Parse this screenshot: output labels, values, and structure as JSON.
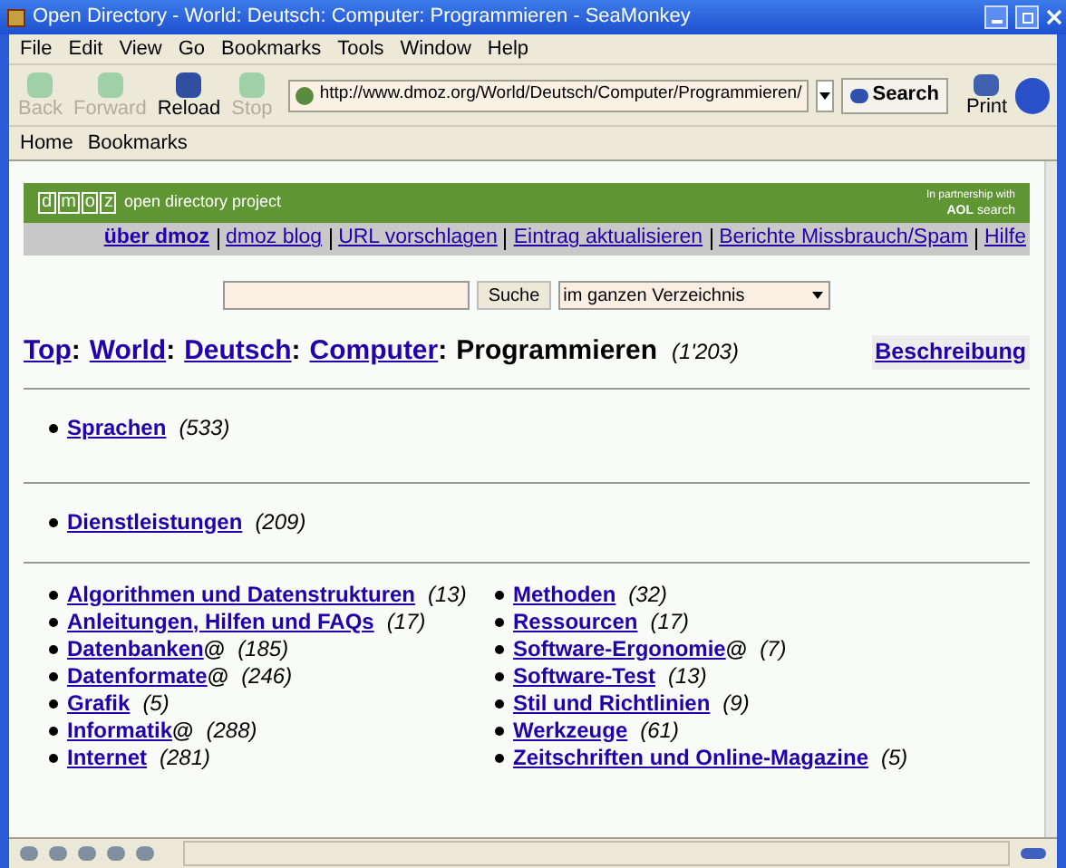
{
  "window": {
    "title": "Open Directory - World: Deutsch: Computer: Programmieren - SeaMonkey"
  },
  "menu": [
    "File",
    "Edit",
    "View",
    "Go",
    "Bookmarks",
    "Tools",
    "Window",
    "Help"
  ],
  "toolbar": {
    "buttons": [
      {
        "label": "Back",
        "disabled": true
      },
      {
        "label": "Forward",
        "disabled": true
      },
      {
        "label": "Reload",
        "disabled": false
      },
      {
        "label": "Stop",
        "disabled": true
      }
    ],
    "url": "http://www.dmoz.org/World/Deutsch/Computer/Programmieren/",
    "search": "Search",
    "print": "Print"
  },
  "personal_bar": [
    "Home",
    "Bookmarks"
  ],
  "page": {
    "logo": [
      "d",
      "m",
      "o",
      "z"
    ],
    "tagline": "open directory project",
    "partner": {
      "line1": "In partnership with",
      "brand": "AOL",
      "word": "search"
    },
    "nav": [
      "über dmoz",
      "dmoz blog",
      "URL vorschlagen",
      "Eintrag aktualisieren",
      "Berichte Missbrauch/Spam",
      "Hilfe"
    ],
    "search_button": "Suche",
    "scope": "im ganzen Verzeichnis",
    "breadcrumb": [
      {
        "label": "Top",
        "suffix": ":"
      },
      {
        "label": "World",
        "suffix": ":"
      },
      {
        "label": "Deutsch",
        "suffix": ":"
      },
      {
        "label": "Computer",
        "suffix": ":"
      }
    ],
    "current": "Programmieren",
    "total": "(1'203)",
    "description_link": "Beschreibung",
    "sections": [
      [
        {
          "label": "Sprachen",
          "count": "(533)"
        }
      ],
      [
        {
          "label": "Dienstleistungen",
          "count": "(209)"
        }
      ]
    ],
    "columns": [
      [
        {
          "label": "Algorithmen und Datenstrukturen",
          "count": "(13)"
        },
        {
          "label": "Anleitungen, Hilfen und FAQs",
          "count": "(17)"
        },
        {
          "label": "Datenbanken",
          "symlink": "@",
          "count": "(185)"
        },
        {
          "label": "Datenformate",
          "symlink": "@",
          "count": "(246)"
        },
        {
          "label": "Grafik",
          "count": "(5)"
        },
        {
          "label": "Informatik",
          "symlink": "@",
          "count": "(288)"
        },
        {
          "label": "Internet",
          "count": "(281)"
        }
      ],
      [
        {
          "label": "Methoden",
          "count": "(32)"
        },
        {
          "label": "Ressourcen",
          "count": "(17)"
        },
        {
          "label": "Software-Ergonomie",
          "symlink": "@",
          "count": "(7)"
        },
        {
          "label": "Software-Test",
          "count": "(13)"
        },
        {
          "label": "Stil und Richtlinien",
          "count": "(9)"
        },
        {
          "label": "Werkzeuge",
          "count": "(61)"
        },
        {
          "label": "Zeitschriften und Online-Magazine",
          "count": "(5)"
        }
      ]
    ]
  }
}
